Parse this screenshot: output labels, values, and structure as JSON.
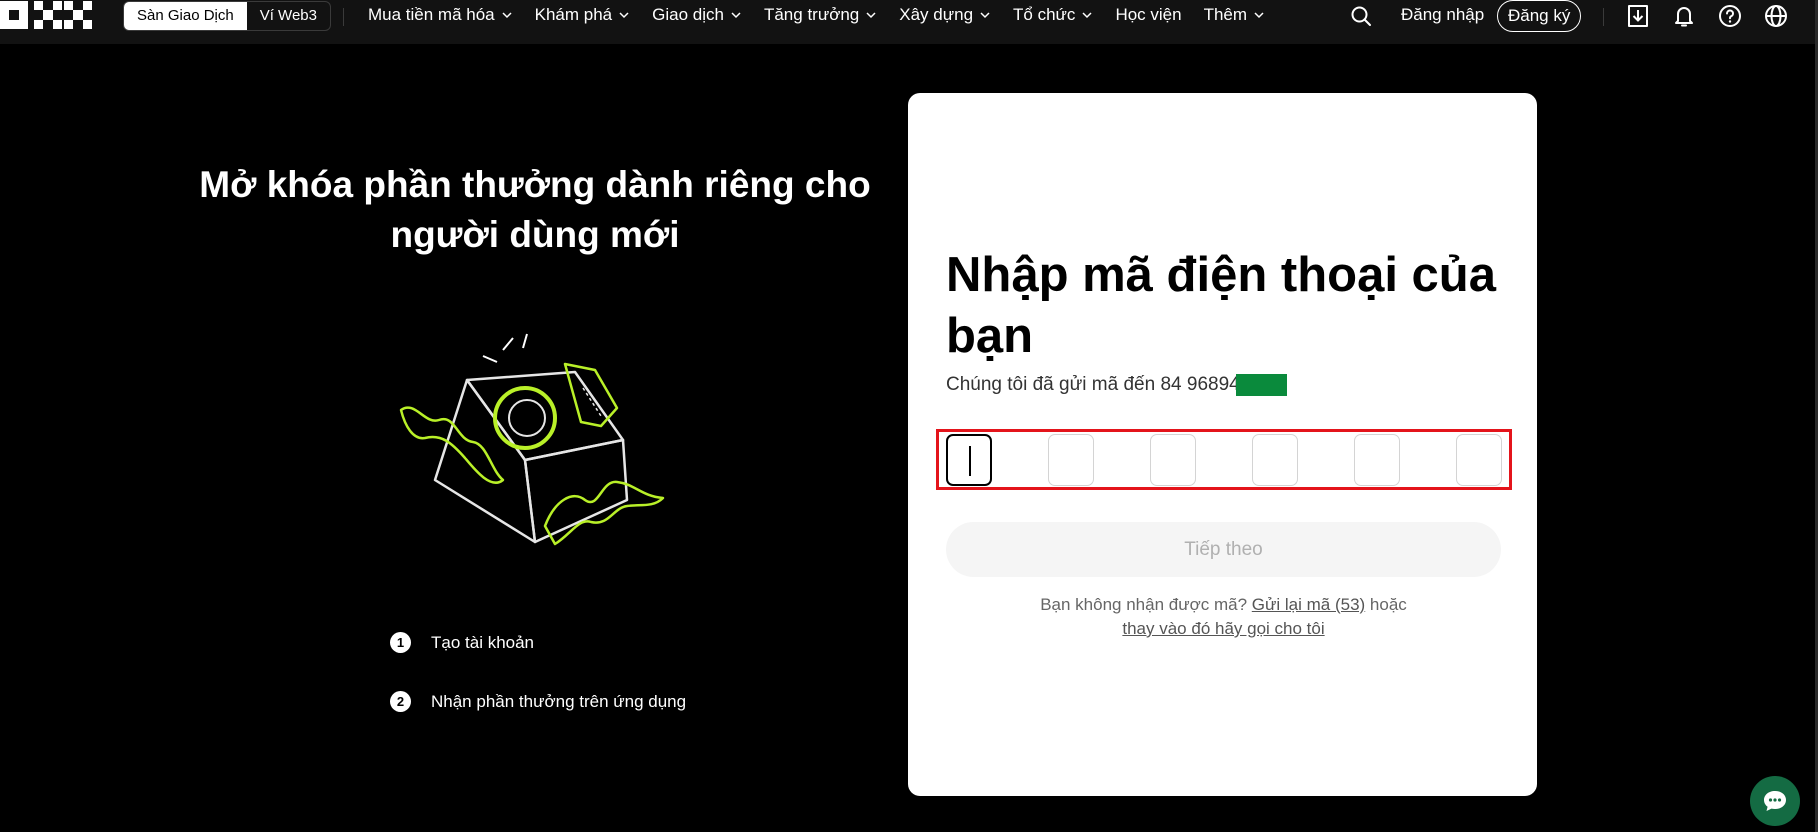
{
  "nav": {
    "mode_tabs": [
      "Sàn Giao Dịch",
      "Ví Web3"
    ],
    "menu": [
      {
        "label": "Mua tiền mã hóa",
        "has_dropdown": true
      },
      {
        "label": "Khám phá",
        "has_dropdown": true
      },
      {
        "label": "Giao dịch",
        "has_dropdown": true
      },
      {
        "label": "Tăng trưởng",
        "has_dropdown": true
      },
      {
        "label": "Xây dựng",
        "has_dropdown": true
      },
      {
        "label": "Tổ chức",
        "has_dropdown": true
      },
      {
        "label": "Học viện",
        "has_dropdown": false
      },
      {
        "label": "Thêm",
        "has_dropdown": true
      }
    ],
    "login": "Đăng nhập",
    "signup": "Đăng ký",
    "icons": [
      "search-icon",
      "download-icon",
      "bell-icon",
      "help-icon",
      "globe-icon"
    ]
  },
  "promo": {
    "title": "Mở khóa phần thưởng dành riêng cho người dùng mới",
    "steps": [
      {
        "num": "1",
        "label": "Tạo tài khoản"
      },
      {
        "num": "2",
        "label": "Nhận phần thưởng trên ứng dụng"
      }
    ]
  },
  "verify": {
    "title": "Nhập mã điện thoại của bạn",
    "sent_text": "Chúng tôi đã gửi mã đến 84 96894",
    "otp_length": 6,
    "next_label": "Tiếp theo",
    "resend_prefix": "Bạn không nhận được mã?",
    "resend_link": "Gửi lại mã (53)",
    "resend_or": "hoặc",
    "call_link": "thay vào đó hãy gọi cho tôi"
  },
  "colors": {
    "accent_lime": "#b9f028",
    "mask_green": "#0a8a3c",
    "highlight_red": "#e4141b",
    "chat_green": "#146b43"
  }
}
